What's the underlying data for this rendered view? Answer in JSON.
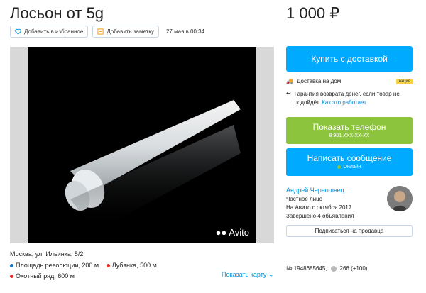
{
  "listing": {
    "title": "Лосьон от 5g",
    "price": "1 000 ₽",
    "favorite_label": "Добавить в избранное",
    "note_label": "Добавить заметку",
    "date": "27 мая в 00:34"
  },
  "photo": {
    "watermark": "Avito"
  },
  "location": {
    "address": "Москва, ул. Ильинка, 5/2",
    "metro": [
      {
        "name": "Площадь революции, 200 м",
        "color": "#1a75c4"
      },
      {
        "name": "Лубянка, 500 м",
        "color": "#e0312d"
      },
      {
        "name": "Охотный ряд, 600 м",
        "color": "#e0312d"
      }
    ],
    "map_link": "Показать карту"
  },
  "buy_button": {
    "label": "Купить с доставкой"
  },
  "delivery": {
    "label": "Доставка на дом",
    "badge": "Акция"
  },
  "guarantee": {
    "text": "Гарантия возврата денег, если товар не подойдёт.",
    "link": "Как это работает"
  },
  "phone_button": {
    "label": "Показать телефон",
    "number": "8 901 XXX-XX-XX"
  },
  "message_button": {
    "label": "Написать сообщение",
    "status": "Онлайн"
  },
  "seller": {
    "name": "Андрей Черношвец",
    "type": "Частное лицо",
    "since": "На Авито с октября 2017",
    "completed": "Завершено 4 объявления",
    "subscribe_label": "Подписаться на продавца"
  },
  "meta": {
    "ad_number": "№ 1948685645,",
    "views": "266 (+100)"
  },
  "colors": {
    "accent_blue": "#00aaff",
    "accent_green": "#8dc43e",
    "link": "#0091d9"
  }
}
